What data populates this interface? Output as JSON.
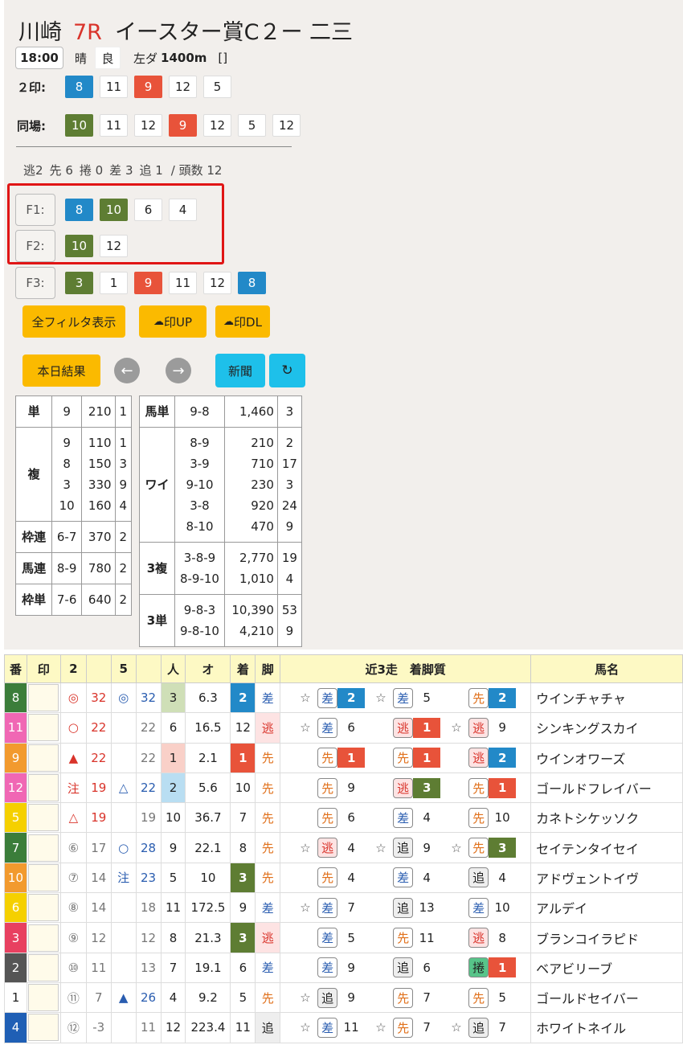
{
  "race": {
    "venue": "川崎",
    "number": "7R",
    "name": "イースター賞C２ー 二三",
    "time": "18:00",
    "weather": "晴",
    "track": "良",
    "course": "左ダ",
    "distance": "1400m",
    "bracket": "[]"
  },
  "marks2": {
    "label": "２印:",
    "values": [
      "8",
      "11",
      "9",
      "12",
      "5"
    ],
    "colors": [
      "blue",
      "",
      "red",
      "",
      ""
    ]
  },
  "same": {
    "label": "同場:",
    "values": [
      "10",
      "11",
      "12",
      "9",
      "12",
      "5",
      "12"
    ],
    "colors": [
      "green",
      "",
      "",
      "red",
      "",
      "",
      ""
    ]
  },
  "style": {
    "nige": "逃2",
    "sen": "先 6",
    "makuri": "捲 0",
    "sashi": "差 3",
    "oi": "追 1",
    "count": "/ 頭数 12"
  },
  "filters": [
    {
      "label": "F1:",
      "values": [
        "8",
        "10",
        "6",
        "4"
      ],
      "colors": [
        "blue",
        "green",
        "",
        ""
      ]
    },
    {
      "label": "F2:",
      "values": [
        "10",
        "12"
      ],
      "colors": [
        "green",
        ""
      ]
    },
    {
      "label": "F3:",
      "values": [
        "3",
        "1",
        "9",
        "11",
        "12",
        "8"
      ],
      "colors": [
        "green",
        "",
        "red",
        "",
        "",
        "blue"
      ]
    }
  ],
  "buttons": {
    "all_filters": "全フィルタ表示",
    "upload": "印UP",
    "download": "印DL",
    "today": "本日結果",
    "prev": "←",
    "next": "→",
    "news": "新聞",
    "refresh": "↻"
  },
  "payout_left": {
    "win": {
      "label": "単",
      "rows": [
        [
          "9",
          "210",
          "1"
        ]
      ]
    },
    "place": {
      "label": "複",
      "rows": [
        [
          "9",
          "110",
          "1"
        ],
        [
          "8",
          "150",
          "3"
        ],
        [
          "3",
          "330",
          "9"
        ],
        [
          "10",
          "160",
          "4"
        ]
      ]
    },
    "bracket_q": {
      "label": "枠連",
      "rows": [
        [
          "6-7",
          "370",
          "2"
        ]
      ]
    },
    "quinella": {
      "label": "馬連",
      "rows": [
        [
          "8-9",
          "780",
          "2"
        ]
      ]
    },
    "bracket_ex": {
      "label": "枠単",
      "rows": [
        [
          "7-6",
          "640",
          "2"
        ]
      ]
    }
  },
  "payout_right": {
    "exacta": {
      "label": "馬単",
      "rows": [
        [
          "9-8",
          "1,460",
          "3"
        ]
      ]
    },
    "wide": {
      "label": "ワイ",
      "rows": [
        [
          "8-9",
          "210",
          "2"
        ],
        [
          "3-9",
          "710",
          "17"
        ],
        [
          "9-10",
          "230",
          "3"
        ],
        [
          "3-8",
          "920",
          "24"
        ],
        [
          "8-10",
          "470",
          "9"
        ]
      ]
    },
    "trio": {
      "label": "3複",
      "rows": [
        [
          "3-8-9",
          "2,770",
          "19"
        ],
        [
          "8-9-10",
          "1,010",
          "4"
        ]
      ]
    },
    "trifecta": {
      "label": "3単",
      "rows": [
        [
          "9-8-3",
          "10,390",
          "53"
        ],
        [
          "9-8-10",
          "4,210",
          "9"
        ]
      ]
    }
  },
  "table": {
    "headers": [
      "番",
      "印",
      "2",
      "",
      "5",
      "",
      "人",
      "オ",
      "着",
      "脚",
      "近3走　着脚質",
      "馬名"
    ],
    "rows": [
      {
        "no": "8",
        "nc": "#3b7d3a",
        "ntc": "#fff",
        "mark2": "◎",
        "m2c": "#d9342b",
        "v2": "32",
        "v2c": "#d9342b",
        "mark5": "◎",
        "m5c": "#2a5db0",
        "v5": "32",
        "v5c": "#2a5db0",
        "pop": "3",
        "popbg": "#cfdfb7",
        "odds": "6.3",
        "fin": "2",
        "finbg": "#2289c8",
        "leg": "差",
        "legc": "#2a5db0",
        "legbg": "",
        "recent": [
          [
            "☆",
            "差",
            "2"
          ],
          [
            "☆",
            "差",
            "5"
          ],
          [
            "",
            "先",
            "2"
          ]
        ],
        "name": "ウインチャチャ"
      },
      {
        "no": "11",
        "nc": "#f067b4",
        "ntc": "#fff",
        "mark2": "○",
        "m2c": "#d9342b",
        "v2": "22",
        "v2c": "#d9342b",
        "mark5": "",
        "m5c": "",
        "v5": "22",
        "v5c": "#777",
        "pop": "6",
        "popbg": "",
        "odds": "16.5",
        "fin": "12",
        "finbg": "",
        "leg": "逃",
        "legc": "#d9342b",
        "legbg": "#fde3e3",
        "recent": [
          [
            "☆",
            "差",
            "6"
          ],
          [
            "",
            "逃",
            "1"
          ],
          [
            "☆",
            "逃",
            "9"
          ]
        ],
        "name": "シンキングスカイ"
      },
      {
        "no": "9",
        "nc": "#f29a2e",
        "ntc": "#fff",
        "mark2": "▲",
        "m2c": "#d9342b",
        "v2": "22",
        "v2c": "#d9342b",
        "mark5": "",
        "m5c": "",
        "v5": "22",
        "v5c": "#777",
        "pop": "1",
        "popbg": "#f9d0c8",
        "odds": "2.1",
        "fin": "1",
        "finbg": "#e8533a",
        "leg": "先",
        "legc": "#e0701b",
        "legbg": "",
        "recent": [
          [
            "",
            "先",
            "1"
          ],
          [
            "",
            "先",
            "1"
          ],
          [
            "",
            "逃",
            "2"
          ]
        ],
        "name": "ウインオワーズ"
      },
      {
        "no": "12",
        "nc": "#f067b4",
        "ntc": "#fff",
        "mark2": "注",
        "m2c": "#d9342b",
        "v2": "19",
        "v2c": "#d9342b",
        "mark5": "△",
        "m5c": "#2a5db0",
        "v5": "22",
        "v5c": "#2a5db0",
        "pop": "2",
        "popbg": "#b9def2",
        "odds": "5.6",
        "fin": "10",
        "finbg": "",
        "leg": "先",
        "legc": "#e0701b",
        "legbg": "",
        "recent": [
          [
            "",
            "先",
            "9"
          ],
          [
            "",
            "逃",
            "3"
          ],
          [
            "",
            "先",
            "1"
          ]
        ],
        "name": "ゴールドフレイバー"
      },
      {
        "no": "5",
        "nc": "#f5d000",
        "ntc": "#fff",
        "mark2": "△",
        "m2c": "#d9342b",
        "v2": "19",
        "v2c": "#d9342b",
        "mark5": "",
        "m5c": "",
        "v5": "19",
        "v5c": "#777",
        "pop": "10",
        "popbg": "",
        "odds": "36.7",
        "fin": "7",
        "finbg": "",
        "leg": "先",
        "legc": "#e0701b",
        "legbg": "",
        "recent": [
          [
            "",
            "先",
            "6"
          ],
          [
            "",
            "差",
            "4"
          ],
          [
            "",
            "先",
            "10"
          ]
        ],
        "name": "カネトシケッソク"
      },
      {
        "no": "7",
        "nc": "#3b7d3a",
        "ntc": "#fff",
        "mark2": "⑥",
        "m2c": "#777",
        "v2": "17",
        "v2c": "#777",
        "mark5": "○",
        "m5c": "#2a5db0",
        "v5": "28",
        "v5c": "#2a5db0",
        "pop": "9",
        "popbg": "",
        "odds": "22.1",
        "fin": "8",
        "finbg": "",
        "leg": "先",
        "legc": "#e0701b",
        "legbg": "",
        "recent": [
          [
            "☆",
            "逃",
            "4"
          ],
          [
            "☆",
            "追",
            "9"
          ],
          [
            "☆",
            "先",
            "3"
          ]
        ],
        "name": "セイテンタイセイ"
      },
      {
        "no": "10",
        "nc": "#f29a2e",
        "ntc": "#fff",
        "mark2": "⑦",
        "m2c": "#777",
        "v2": "14",
        "v2c": "#777",
        "mark5": "注",
        "m5c": "#2a5db0",
        "v5": "23",
        "v5c": "#2a5db0",
        "pop": "5",
        "popbg": "",
        "odds": "10",
        "fin": "3",
        "finbg": "#5e7d33",
        "leg": "先",
        "legc": "#e0701b",
        "legbg": "",
        "recent": [
          [
            "",
            "先",
            "4"
          ],
          [
            "",
            "差",
            "4"
          ],
          [
            "",
            "追",
            "4"
          ]
        ],
        "name": "アドヴェントイヴ"
      },
      {
        "no": "6",
        "nc": "#f5d000",
        "ntc": "#fff",
        "mark2": "⑧",
        "m2c": "#777",
        "v2": "14",
        "v2c": "#777",
        "mark5": "",
        "m5c": "",
        "v5": "18",
        "v5c": "#777",
        "pop": "11",
        "popbg": "",
        "odds": "172.5",
        "fin": "9",
        "finbg": "",
        "leg": "差",
        "legc": "#2a5db0",
        "legbg": "",
        "recent": [
          [
            "☆",
            "差",
            "7"
          ],
          [
            "",
            "追",
            "13"
          ],
          [
            "",
            "差",
            "10"
          ]
        ],
        "name": "アルデイ"
      },
      {
        "no": "3",
        "nc": "#e84060",
        "ntc": "#fff",
        "mark2": "⑨",
        "m2c": "#777",
        "v2": "12",
        "v2c": "#777",
        "mark5": "",
        "m5c": "",
        "v5": "12",
        "v5c": "#777",
        "pop": "8",
        "popbg": "",
        "odds": "21.3",
        "fin": "3",
        "finbg": "#5e7d33",
        "leg": "逃",
        "legc": "#d9342b",
        "legbg": "#fde3e3",
        "recent": [
          [
            "",
            "差",
            "5"
          ],
          [
            "",
            "先",
            "11"
          ],
          [
            "",
            "逃",
            "8"
          ]
        ],
        "name": "ブランコイラピド"
      },
      {
        "no": "2",
        "nc": "#555",
        "ntc": "#fff",
        "mark2": "⑩",
        "m2c": "#777",
        "v2": "11",
        "v2c": "#777",
        "mark5": "",
        "m5c": "",
        "v5": "13",
        "v5c": "#777",
        "pop": "7",
        "popbg": "",
        "odds": "19.1",
        "fin": "6",
        "finbg": "",
        "leg": "差",
        "legc": "#2a5db0",
        "legbg": "",
        "recent": [
          [
            "",
            "差",
            "9"
          ],
          [
            "",
            "追",
            "6"
          ],
          [
            "",
            "捲",
            "1"
          ]
        ],
        "name": "ベアビリーブ"
      },
      {
        "no": "1",
        "nc": "#fff",
        "ntc": "#222",
        "mark2": "⑪",
        "m2c": "#777",
        "v2": "7",
        "v2c": "#777",
        "mark5": "▲",
        "m5c": "#2a5db0",
        "v5": "26",
        "v5c": "#2a5db0",
        "pop": "4",
        "popbg": "",
        "odds": "9.2",
        "fin": "5",
        "finbg": "",
        "leg": "先",
        "legc": "#e0701b",
        "legbg": "",
        "recent": [
          [
            "☆",
            "追",
            "9"
          ],
          [
            "",
            "先",
            "7"
          ],
          [
            "",
            "先",
            "5"
          ]
        ],
        "name": "ゴールドセイバー"
      },
      {
        "no": "4",
        "nc": "#1f5fb5",
        "ntc": "#fff",
        "mark2": "⑫",
        "m2c": "#777",
        "v2": "-3",
        "v2c": "#777",
        "mark5": "",
        "m5c": "",
        "v5": "11",
        "v5c": "#777",
        "pop": "12",
        "popbg": "",
        "odds": "223.4",
        "fin": "11",
        "finbg": "",
        "leg": "追",
        "legc": "#222",
        "legbg": "#eee",
        "recent": [
          [
            "☆",
            "差",
            "11"
          ],
          [
            "☆",
            "先",
            "7"
          ],
          [
            "☆",
            "追",
            "7"
          ]
        ],
        "name": "ホワイトネイル"
      }
    ]
  },
  "colors": {
    "blue": "#2289c8",
    "green": "#5e7d33",
    "red": "#e8533a",
    "yellow": "#fbba00",
    "cyan": "#1ec0ea",
    "highlight": "#e01515"
  }
}
